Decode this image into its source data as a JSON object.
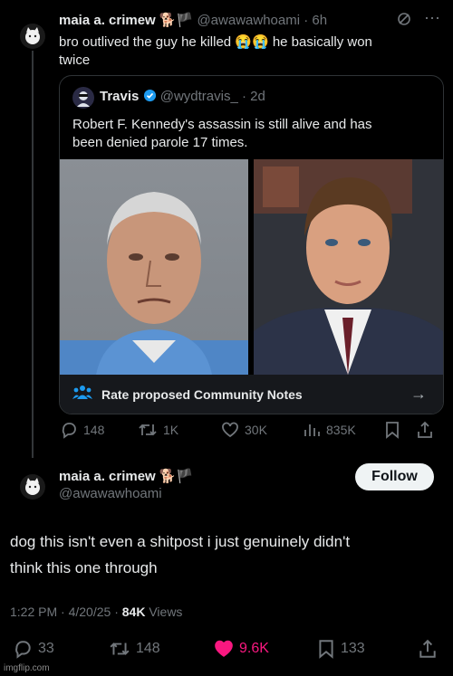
{
  "reply": {
    "name": "maia a. crimew",
    "handle": "@awawawhoami",
    "time": "6h",
    "text_line1_a": "bro outlived the guy he killed",
    "text_line1_b": "he basically won",
    "text_line2": "twice"
  },
  "quoted": {
    "name": "Travis",
    "handle": "@wydtravis_",
    "time": "2d",
    "text_line1": "Robert F. Kennedy's assassin is still alive and has",
    "text_line2": "been denied parole 17 times.",
    "community_notes_label": "Rate proposed Community Notes"
  },
  "reply_actions": {
    "replies": "148",
    "reposts": "1K",
    "likes": "30K",
    "views": "835K"
  },
  "main": {
    "name": "maia a. crimew",
    "handle": "@awawawhoami",
    "follow_label": "Follow",
    "text_line1": "dog this isn't even a shitpost i just genuinely didn't",
    "text_line2": "think this one through",
    "time": "1:22 PM",
    "date": "4/20/25",
    "views_count": "84K",
    "views_label": "Views"
  },
  "main_actions": {
    "replies": "33",
    "reposts": "148",
    "likes": "9.6K",
    "bookmarks": "133"
  },
  "watermark": "imgflip.com",
  "colors": {
    "like": "#f91880",
    "verified": "#1d9bf0",
    "link": "#1d9bf0"
  }
}
